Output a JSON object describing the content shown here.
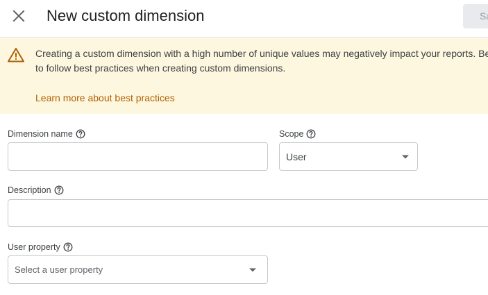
{
  "header": {
    "title": "New custom dimension",
    "save_label": "Save",
    "close_icon": "close-icon"
  },
  "banner": {
    "icon": "warning-icon",
    "text": "Creating a custom dimension with a high number of unique values may negatively impact your reports. Be sure to follow best practices when creating custom dimensions.",
    "link": "Learn more about best practices",
    "background": "#fef7e0",
    "icon_color": "#b06000"
  },
  "form": {
    "dimension_name": {
      "label": "Dimension name",
      "value": ""
    },
    "scope": {
      "label": "Scope",
      "value": "User"
    },
    "description": {
      "label": "Description",
      "value": ""
    },
    "user_property": {
      "label": "User property",
      "placeholder": "Select a user property"
    }
  }
}
